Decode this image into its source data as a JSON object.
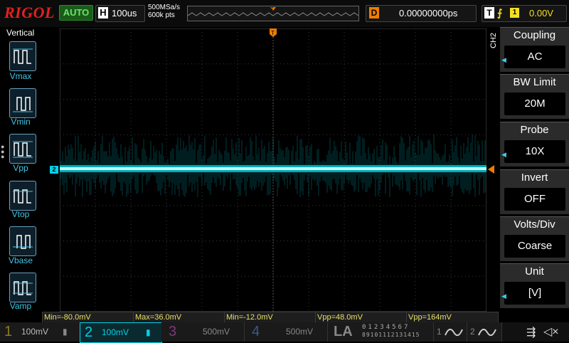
{
  "header": {
    "brand": "RIGOL",
    "run_state": "AUTO",
    "horizontal": {
      "letter": "H",
      "timebase": "100us"
    },
    "acquisition": {
      "sample_rate": "500MSa/s",
      "memory_depth": "600k pts"
    },
    "delay": {
      "letter": "D",
      "value": "0.00000000ps"
    },
    "trigger": {
      "letter": "T",
      "edge_icon": "rising-edge-icon",
      "source": "1",
      "level": "0.00V"
    }
  },
  "left_panel": {
    "title": "Vertical",
    "measures": [
      "Vmax",
      "Vmin",
      "Vpp",
      "Vtop",
      "Vbase",
      "Vamp"
    ]
  },
  "menu": {
    "channel": "CH2",
    "items": [
      {
        "title": "Coupling",
        "value": "AC",
        "has_arrow": true
      },
      {
        "title": "BW Limit",
        "value": "20M",
        "has_arrow": false
      },
      {
        "title": "Probe",
        "value": "10X",
        "has_arrow": true
      },
      {
        "title": "Invert",
        "value": "OFF",
        "has_arrow": false
      },
      {
        "title": "Volts/Div",
        "value": "Coarse",
        "has_arrow": false
      },
      {
        "title": "Unit",
        "value": "[V]",
        "has_arrow": true
      }
    ]
  },
  "measurements": [
    "Min=-80.0mV",
    "Max=36.0mV",
    "Min=-12.0mV",
    "Vpp=48.0mV",
    "Vpp=164mV"
  ],
  "channels": [
    {
      "num": "1",
      "scale": "100mV",
      "color": "#d8c020",
      "active": false
    },
    {
      "num": "2",
      "scale": "100mV",
      "color": "#00d0e8",
      "active": true
    },
    {
      "num": "3",
      "scale": "500mV",
      "color": "#c040c0",
      "active": false
    },
    {
      "num": "4",
      "scale": "500mV",
      "color": "#3070e0",
      "active": false
    }
  ],
  "la": {
    "label": "LA",
    "digits_top": [
      "0",
      "1",
      "2",
      "3",
      "4",
      "5",
      "6",
      "7"
    ],
    "digits_bottom": [
      "8",
      "9",
      "10",
      "11",
      "12",
      "13",
      "14",
      "15"
    ]
  },
  "waveform": {
    "channel_marker": "2",
    "color": "#00d8e8"
  },
  "colors": {
    "accent": "#00d0e8",
    "trigger": "#f07c00",
    "measure_text": "#e8e06a"
  }
}
